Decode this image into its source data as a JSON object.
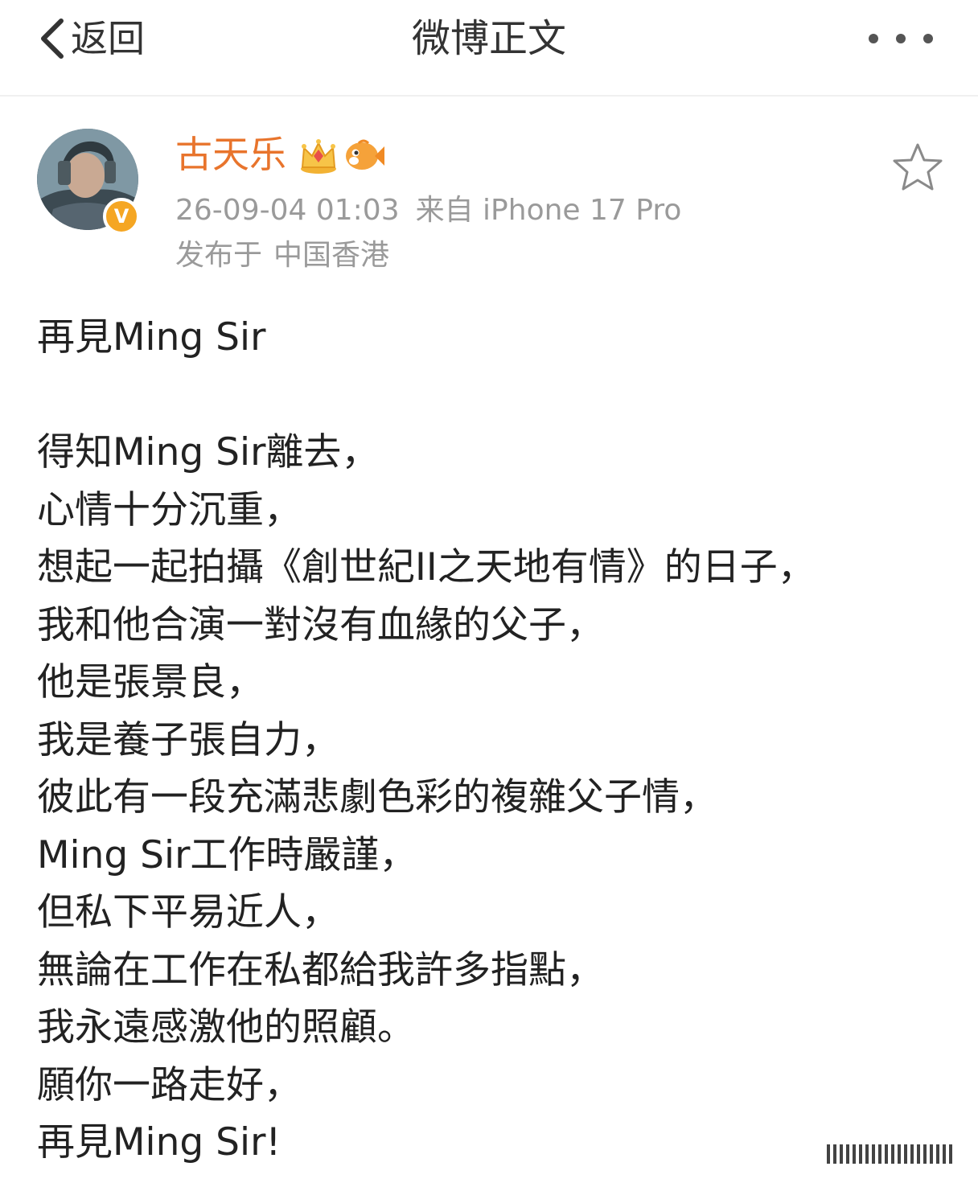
{
  "nav": {
    "back_label": "返回",
    "title": "微博正文"
  },
  "post": {
    "author": "古天乐",
    "verified_mark": "V",
    "time": "26-09-04 01:03",
    "source": "来自 iPhone 17 Pro",
    "location_prefix": "发布于",
    "location": "中国香港",
    "title_line": "再見Ming Sir",
    "lines": [
      "得知Ming Sir離去，",
      "心情十分沉重，",
      "想起一起拍攝《創世紀II之天地有情》的日子，",
      "我和他合演一對沒有血緣的父子，",
      "他是張景良，",
      "我是養子張自力，",
      "彼此有一段充滿悲劇色彩的複雜父子情，",
      "Ming Sir工作時嚴謹，",
      "但私下平易近人，",
      "無論在工作在私都給我許多指點，",
      "我永遠感激他的照顧。",
      "願你一路走好，",
      "再見Ming Sir!"
    ]
  },
  "icons": {
    "back": "chevron-left-icon",
    "more": "more-dots-icon",
    "favorite": "star-outline-icon",
    "badge_1": "crown-icon",
    "badge_2": "fish-icon"
  },
  "colors": {
    "username": "#e8742c",
    "meta": "#9a9a9a",
    "verified": "#f5a623"
  }
}
